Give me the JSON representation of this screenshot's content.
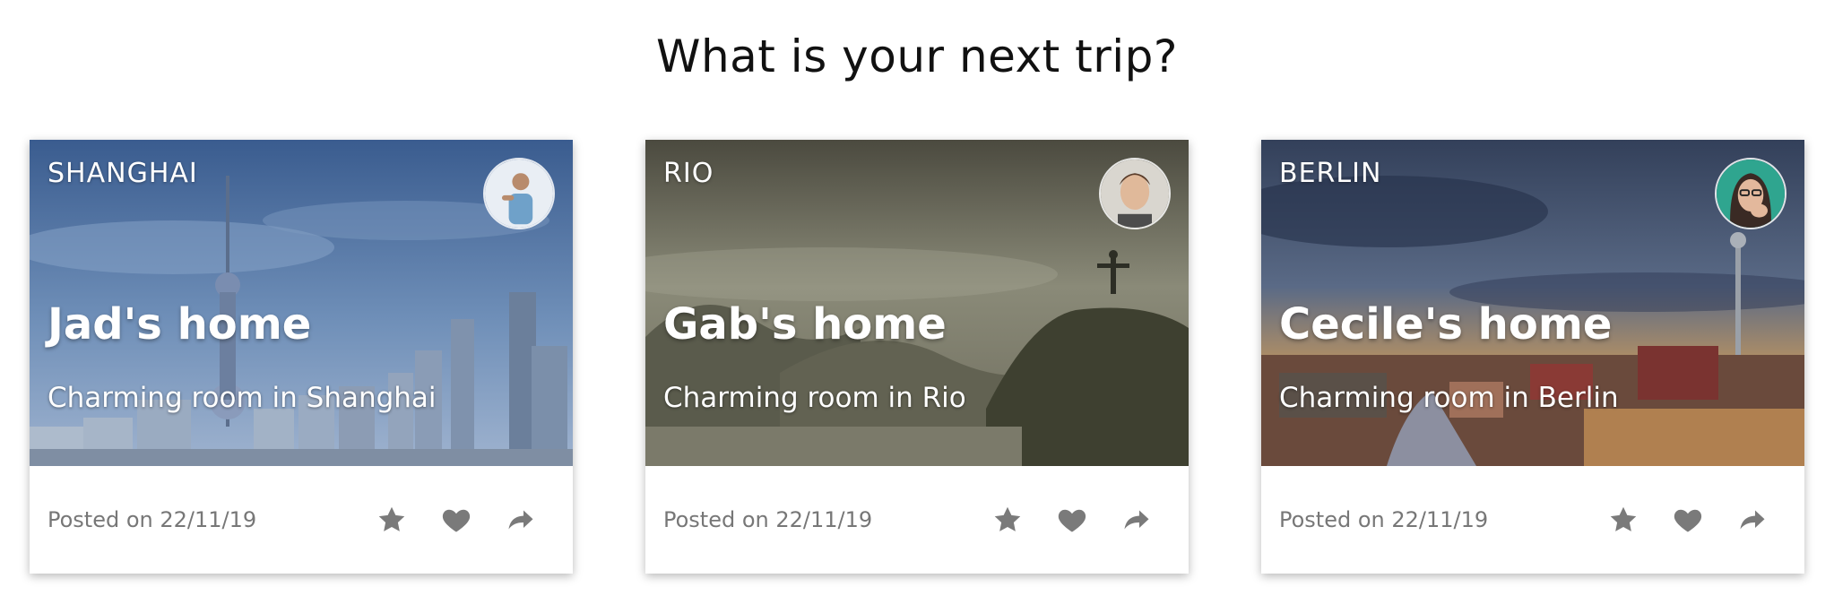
{
  "page": {
    "title": "What is your next trip?"
  },
  "colors": {
    "footer_text": "#777777",
    "icon": "#7a7a7a",
    "overlay_text": "#ffffff"
  },
  "cards": [
    {
      "city": "SHANGHAI",
      "heading": "Jad's home",
      "subtitle": "Charming room in Shanghai",
      "date": "Posted on 22/11/19",
      "icons": [
        "star-icon",
        "heart-icon",
        "share-icon"
      ]
    },
    {
      "city": "RIO",
      "heading": "Gab's home",
      "subtitle": "Charming room in Rio",
      "date": "Posted on 22/11/19",
      "icons": [
        "star-icon",
        "heart-icon",
        "share-icon"
      ]
    },
    {
      "city": "BERLIN",
      "heading": "Cecile's home",
      "subtitle": "Charming room in Berlin",
      "date": "Posted on 22/11/19",
      "icons": [
        "star-icon",
        "heart-icon",
        "share-icon"
      ]
    }
  ]
}
